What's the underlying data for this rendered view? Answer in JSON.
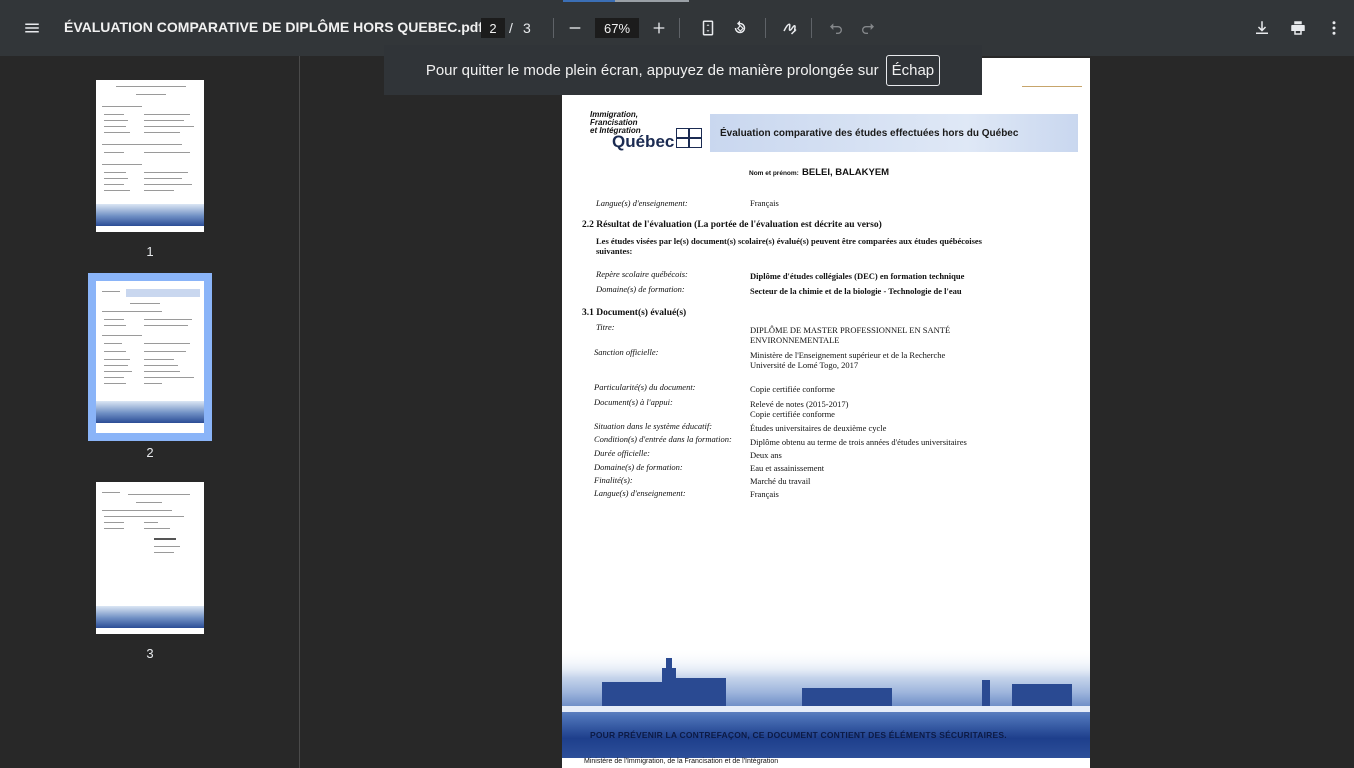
{
  "toolbar": {
    "title": "ÉVALUATION COMPARATIVE DE DIPLÔME HORS QUEBEC.pdf",
    "current_page": "2",
    "page_separator": "/",
    "total_pages": "3",
    "zoom": "67%",
    "icons": [
      "menu-icon",
      "zoom-out-icon",
      "zoom-in-icon",
      "fit-page-icon",
      "rotate-icon",
      "annotate-icon",
      "undo-icon",
      "redo-icon",
      "download-icon",
      "print-icon",
      "more-vert-icon"
    ]
  },
  "fullscreen_toast": {
    "text": "Pour quitter le mode plein écran, appuyez de manière prolongée sur",
    "key": "Échap"
  },
  "thumbnails": [
    {
      "number": "1",
      "selected": false
    },
    {
      "number": "2",
      "selected": true
    },
    {
      "number": "3",
      "selected": false
    }
  ],
  "document": {
    "logo": {
      "line1": "Immigration,",
      "line2": "Francisation",
      "line3": "et Intégration",
      "brand": "Québec"
    },
    "banner_title": "Évaluation comparative des études effectuées hors du Québec",
    "name_label": "Nom et prénom:",
    "name_value": "BELEI, BALAKYEM",
    "language_label": "Langue(s) d'enseignement:",
    "language_value": "Français",
    "section_2_2": {
      "heading": "2.2 Résultat de l'évaluation (La portée de l'évaluation est décrite au verso)",
      "subtitle": "Les études visées par le(s) document(s) scolaire(s) évalué(s) peuvent être comparées aux études québécoises suivantes:",
      "reference_label": "Repère scolaire québécois:",
      "reference_value": "Diplôme d'études collégiales (DEC) en formation technique",
      "domain_label": "Domaine(s) de formation:",
      "domain_value": "Secteur de la chimie et de la biologie - Technologie de l'eau"
    },
    "section_3_1": {
      "heading": "3.1 Document(s) évalué(s)",
      "fields": [
        {
          "label": "Titre:",
          "value": "DIPLÔME DE MASTER PROFESSIONNEL EN SANTÉ ENVIRONNEMENTALE"
        },
        {
          "label": "Sanction officielle:",
          "value": "Ministère de l'Enseignement supérieur et de la Recherche Université de Lomé Togo, 2017"
        },
        {
          "label": "Particularité(s) du document:",
          "value": "Copie certifiée conforme"
        },
        {
          "label": "Document(s) à l'appui:",
          "value": "Relevé de notes (2015-2017) Copie certifiée conforme"
        },
        {
          "label": "Situation dans le système éducatif:",
          "value": "Études universitaires de deuxième cycle"
        },
        {
          "label": "Condition(s) d'entrée dans la formation:",
          "value": "Diplôme obtenu au terme de trois années d'études universitaires"
        },
        {
          "label": "Durée officielle:",
          "value": "Deux ans"
        },
        {
          "label": "Domaine(s) de formation:",
          "value": "Eau et assainissement"
        },
        {
          "label": "Finalité(s):",
          "value": "Marché du travail"
        },
        {
          "label": "Langue(s) d'enseignement:",
          "value": "Français"
        }
      ]
    },
    "security_warning": "POUR PRÉVENIR LA CONTREFAÇON, CE DOCUMENT CONTIENT DES ÉLÉMENTS SÉCURITAIRES.",
    "footer": "Ministère de l'Immigration, de la Francisation et de l'Intégration"
  },
  "colors": {
    "toolbar_bg": "#323639",
    "viewer_bg": "#282828",
    "selection": "#8ab4f8",
    "banner": "#c9d7ef",
    "city_blue": "#2a4a92"
  }
}
